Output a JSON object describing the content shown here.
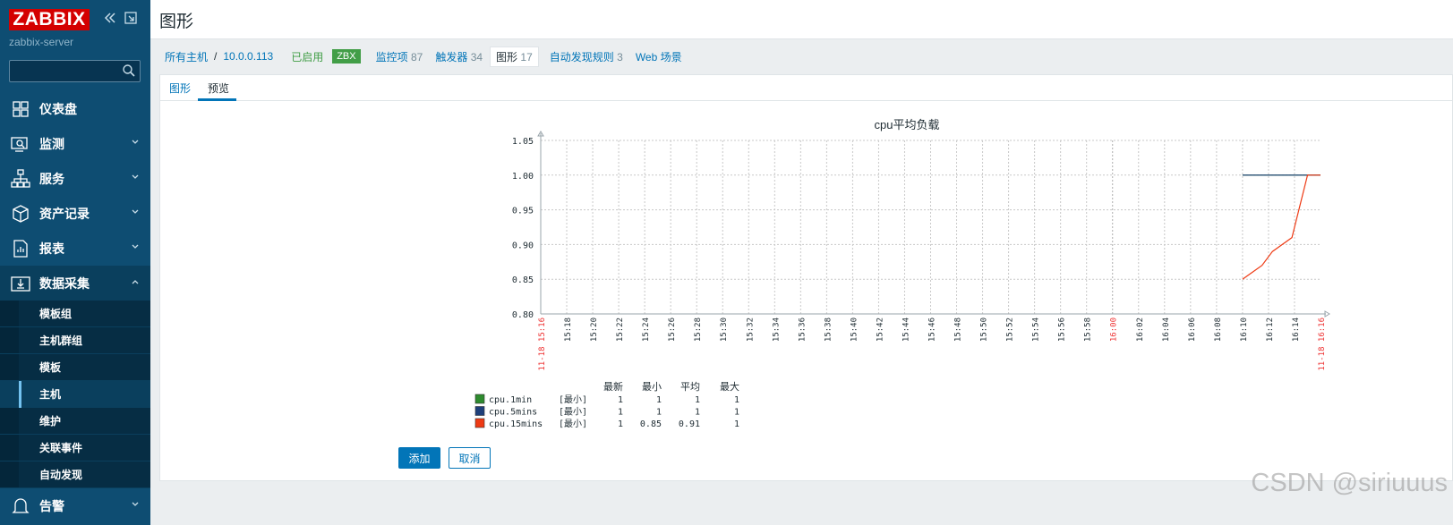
{
  "sidebar": {
    "logo": "ZABBIX",
    "server": "zabbix-server",
    "search": {
      "value": "",
      "placeholder": ""
    },
    "menu": [
      {
        "label": "仪表盘",
        "icon": "dashboard-icon"
      },
      {
        "label": "监测",
        "icon": "monitoring-icon"
      },
      {
        "label": "服务",
        "icon": "services-icon"
      },
      {
        "label": "资产记录",
        "icon": "inventory-icon"
      },
      {
        "label": "报表",
        "icon": "reports-icon"
      },
      {
        "label": "数据采集",
        "icon": "data-collection-icon"
      }
    ],
    "submenu": [
      "模板组",
      "主机群组",
      "模板",
      "主机",
      "维护",
      "关联事件",
      "自动发现"
    ],
    "alerts": "告警"
  },
  "header": {
    "title": "图形"
  },
  "host_nav": {
    "all_hosts": "所有主机",
    "separator": "/",
    "host": "10.0.0.113",
    "status": "已启用",
    "badge": "ZBX",
    "items": [
      {
        "label": "监控项",
        "count": "87"
      },
      {
        "label": "触发器",
        "count": "34"
      },
      {
        "label": "图形",
        "count": "17"
      },
      {
        "label": "自动发现规则",
        "count": "3"
      },
      {
        "label": "Web 场景",
        "count": ""
      }
    ]
  },
  "tabs": [
    "图形",
    "预览"
  ],
  "buttons": {
    "add": "添加",
    "cancel": "取消"
  },
  "watermark": "CSDN @siriuuus",
  "chart_data": {
    "type": "line",
    "title": "cpu平均负载",
    "ylim": [
      0.8,
      1.05
    ],
    "y_ticks": [
      "1.05",
      "1.00",
      "0.95",
      "0.90",
      "0.85",
      "0.80"
    ],
    "x_ticks": [
      "15:18",
      "15:20",
      "15:22",
      "15:24",
      "15:26",
      "15:28",
      "15:30",
      "15:32",
      "15:34",
      "15:36",
      "15:38",
      "15:40",
      "15:42",
      "15:44",
      "15:46",
      "15:48",
      "15:50",
      "15:52",
      "15:54",
      "15:56",
      "15:58",
      "16:00",
      "16:02",
      "16:04",
      "16:06",
      "16:08",
      "16:10",
      "16:12",
      "16:14"
    ],
    "x_start_label": "11-18 15:16",
    "x_end_label": "11-18 16:16",
    "x_highlight": "16:00",
    "x_range_minutes": [
      0,
      60
    ],
    "grid": true,
    "series": [
      {
        "name": "cpu.1min",
        "color": "#2e8b2e",
        "x": [
          54,
          60
        ],
        "values": [
          1,
          1
        ]
      },
      {
        "name": "cpu.5mins",
        "color": "#1e3f7a",
        "x": [
          54,
          60
        ],
        "values": [
          1,
          1
        ]
      },
      {
        "name": "cpu.15mins",
        "color": "#ee3a14",
        "x": [
          54,
          55.5,
          56.3,
          57.8,
          59,
          60
        ],
        "values": [
          0.85,
          0.87,
          0.89,
          0.91,
          1,
          1
        ]
      }
    ],
    "legend": {
      "headers": [
        "最新",
        "最小",
        "平均",
        "最大"
      ],
      "func": "[最小]",
      "rows": [
        {
          "name": "cpu.1min",
          "latest": "1",
          "min": "1",
          "avg": "1",
          "max": "1"
        },
        {
          "name": "cpu.5mins",
          "latest": "1",
          "min": "1",
          "avg": "1",
          "max": "1"
        },
        {
          "name": "cpu.15mins",
          "latest": "1",
          "min": "0.85",
          "avg": "0.91",
          "max": "1"
        }
      ]
    }
  }
}
